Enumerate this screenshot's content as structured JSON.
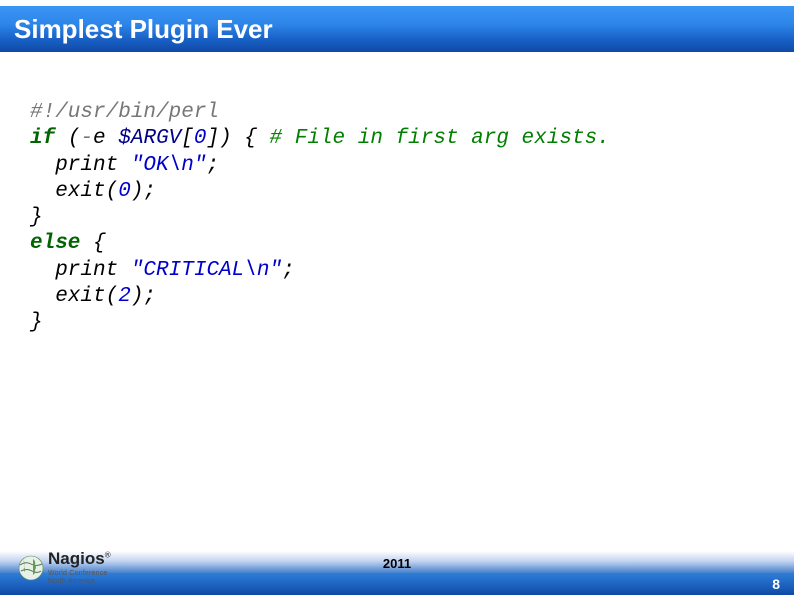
{
  "title": "Simplest Plugin Ever",
  "footer": {
    "year": "2011",
    "page": "8"
  },
  "logo": {
    "name": "Nagios",
    "reg": "®",
    "sub1": "World Conference",
    "sub2": "North America"
  },
  "code": {
    "l1_shebang": "#!/usr/bin/perl",
    "l2_if": "if",
    "l2_open": " (",
    "l2_op": "-",
    "l2_e": "e ",
    "l2_var": "$ARGV",
    "l2_br1": "[",
    "l2_zero": "0",
    "l2_br2": "]) { ",
    "l2_cm": "# File in first arg exists.",
    "l3_print": "  print ",
    "l3_str": "\"OK\\n\"",
    "l3_semi": ";",
    "l4_exit": "  exit(",
    "l4_zero": "0",
    "l4_close": ");",
    "l5": "}",
    "l6_else": "else",
    "l6_brace": " {",
    "l7_print": "  print ",
    "l7_str": "\"CRITICAL\\n\"",
    "l7_semi": ";",
    "l8_exit": "  exit(",
    "l8_two": "2",
    "l8_close": ");",
    "l9": "}"
  }
}
